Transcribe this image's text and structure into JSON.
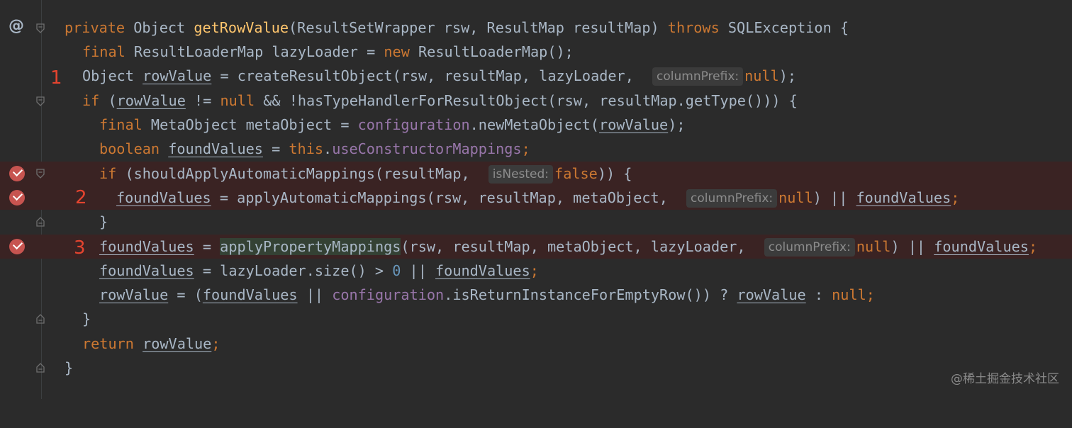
{
  "gutter": {
    "override_symbol": "@",
    "markers": [
      "1",
      "2",
      "3"
    ]
  },
  "code": {
    "l1": {
      "private": "private",
      "object": " Object ",
      "method": "getRowValue",
      "params": "(ResultSetWrapper rsw, ResultMap resultMap) ",
      "throws": "throws",
      "rest": " SQLException {"
    },
    "l2": {
      "final": "final",
      "mid": " ResultLoaderMap lazyLoader = ",
      "new": "new",
      "rest": " ResultLoaderMap();"
    },
    "l3": {
      "pre": "Object ",
      "var": "rowValue",
      "mid": " = createResultObject(rsw, resultMap, lazyLoader, ",
      "hint": "columnPrefix:",
      "null": "null",
      "end": ");"
    },
    "l4": {
      "if": "if",
      "open": " (",
      "var": "rowValue",
      "neq": " != ",
      "null": "null",
      "rest": " && !hasTypeHandlerForResultObject(rsw, resultMap.getType())) {"
    },
    "l5": {
      "final": "final",
      "mid": " MetaObject metaObject = ",
      "field": "configuration",
      "call": ".newMetaObject(",
      "var": "rowValue",
      "end": ");"
    },
    "l6": {
      "boolean": "boolean",
      "sp": " ",
      "var": "foundValues",
      "eq": " = ",
      "this": "this",
      "dot": ".",
      "field": "useConstructorMappings",
      "end": ";"
    },
    "l7": {
      "if": "if",
      "mid": " (shouldApplyAutomaticMappings(resultMap, ",
      "hint": "isNested:",
      "false": "false",
      "end": ")) {"
    },
    "l8": {
      "var": "foundValues",
      "mid": " = applyAutomaticMappings(rsw, resultMap, metaObject, ",
      "hint": "columnPrefix:",
      "null": "null",
      "or": ") || ",
      "var2": "foundValues",
      "end": ";"
    },
    "l9": {
      "brace": "}"
    },
    "l10": {
      "var": "foundValues",
      "eq": " = ",
      "method": "applyPropertyMappings",
      "mid": "(rsw, resultMap, metaObject, lazyLoader, ",
      "hint": "columnPrefix:",
      "null": "null",
      "or": ") || ",
      "var2": "foundValues",
      "end": ";"
    },
    "l11": {
      "var": "foundValues",
      "mid": " = lazyLoader.size() > ",
      "num": "0",
      "or": " || ",
      "var2": "foundValues",
      "end": ";"
    },
    "l12": {
      "var": "rowValue",
      "eq": " = (",
      "var2": "foundValues",
      "or": " || ",
      "field": "configuration",
      "mid": ".isReturnInstanceForEmptyRow()) ? ",
      "var3": "rowValue",
      "colon": " : ",
      "null": "null",
      "end": ";"
    },
    "l13": {
      "brace": "}"
    },
    "l14": {
      "return": "return",
      "sp": " ",
      "var": "rowValue",
      "end": ";"
    },
    "l15": {
      "brace": "}"
    }
  },
  "watermark": "@稀土掘金技术社区",
  "colors": {
    "background": "#2b2b2b",
    "keyword": "#cc7832",
    "method": "#ffc66d",
    "field": "#9876aa",
    "number": "#6897bb",
    "text": "#a9b7c6",
    "breakpoint_line": "#3a2323",
    "breakpoint": "#c75450",
    "marker": "#e5442f"
  }
}
